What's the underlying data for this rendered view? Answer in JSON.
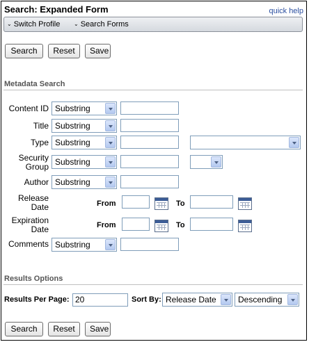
{
  "header": {
    "title": "Search: Expanded Form",
    "help_link": "quick help"
  },
  "menu": {
    "switch_profile": "Switch Profile",
    "search_forms": "Search Forms"
  },
  "buttons": {
    "search": "Search",
    "reset": "Reset",
    "save": "Save"
  },
  "metadata": {
    "section_title": "Metadata Search",
    "content_id_label": "Content ID",
    "title_label": "Title",
    "type_label": "Type",
    "security_group_label_1": "Security",
    "security_group_label_2": "Group",
    "author_label": "Author",
    "release_date_label_1": "Release",
    "release_date_label_2": "Date",
    "expiration_date_label_1": "Expiration",
    "expiration_date_label_2": "Date",
    "comments_label": "Comments",
    "operator": "Substring",
    "from_label": "From",
    "to_label": "To"
  },
  "results": {
    "section_title": "Results Options",
    "per_page_label": "Results Per Page:",
    "per_page_value": "20",
    "sort_by_label": "Sort By:",
    "sort_field": "Release Date",
    "sort_order": "Descending"
  }
}
